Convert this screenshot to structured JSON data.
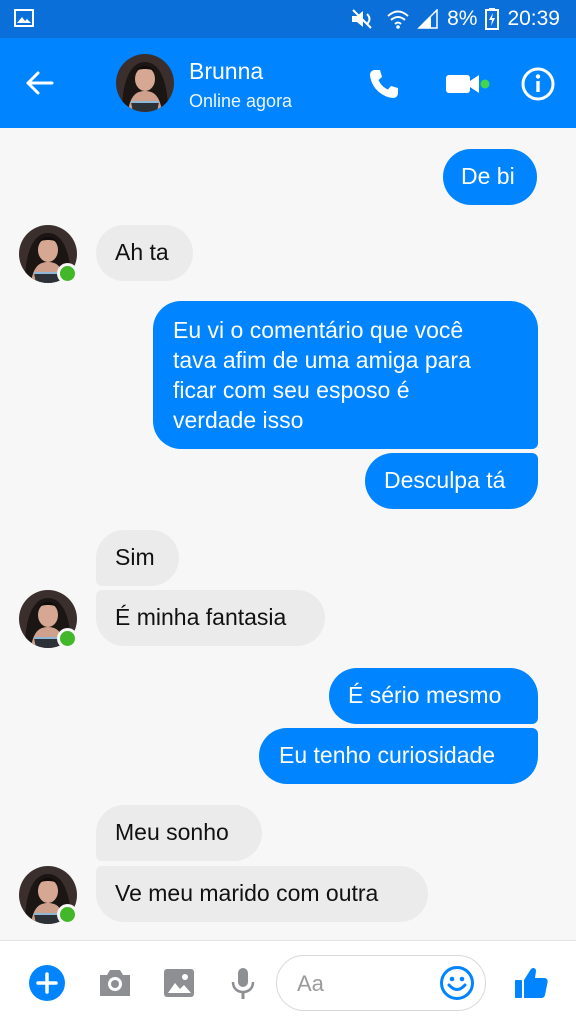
{
  "status_bar": {
    "battery": "8%",
    "time": "20:39"
  },
  "header": {
    "name": "Brunna",
    "status": "Online agora",
    "accent": "#0084ff"
  },
  "messages": [
    {
      "from": "me",
      "text": "De bi"
    },
    {
      "from": "contact",
      "text": "Ah ta"
    },
    {
      "from": "me",
      "text": "Eu vi o comentário que você tava afim de uma amiga para ficar com seu esposo é verdade isso",
      "lines": [
        "Eu vi o comentário que você",
        "tava afim de uma amiga para",
        "ficar com seu esposo é",
        "verdade isso"
      ]
    },
    {
      "from": "me",
      "text": "Desculpa tá"
    },
    {
      "from": "contact",
      "text": "Sim"
    },
    {
      "from": "contact",
      "text": "É minha fantasia"
    },
    {
      "from": "me",
      "text": "É sério mesmo"
    },
    {
      "from": "me",
      "text": "Eu tenho curiosidade"
    },
    {
      "from": "contact",
      "text": "Meu sonho"
    },
    {
      "from": "contact",
      "text": "Ve meu marido com outra"
    }
  ],
  "composer": {
    "placeholder": "Aa"
  },
  "icons": [
    "back-arrow-icon",
    "phone-icon",
    "video-icon",
    "info-icon",
    "plus-icon",
    "camera-icon",
    "image-icon",
    "microphone-icon",
    "emoji-icon",
    "thumbs-up-icon"
  ]
}
